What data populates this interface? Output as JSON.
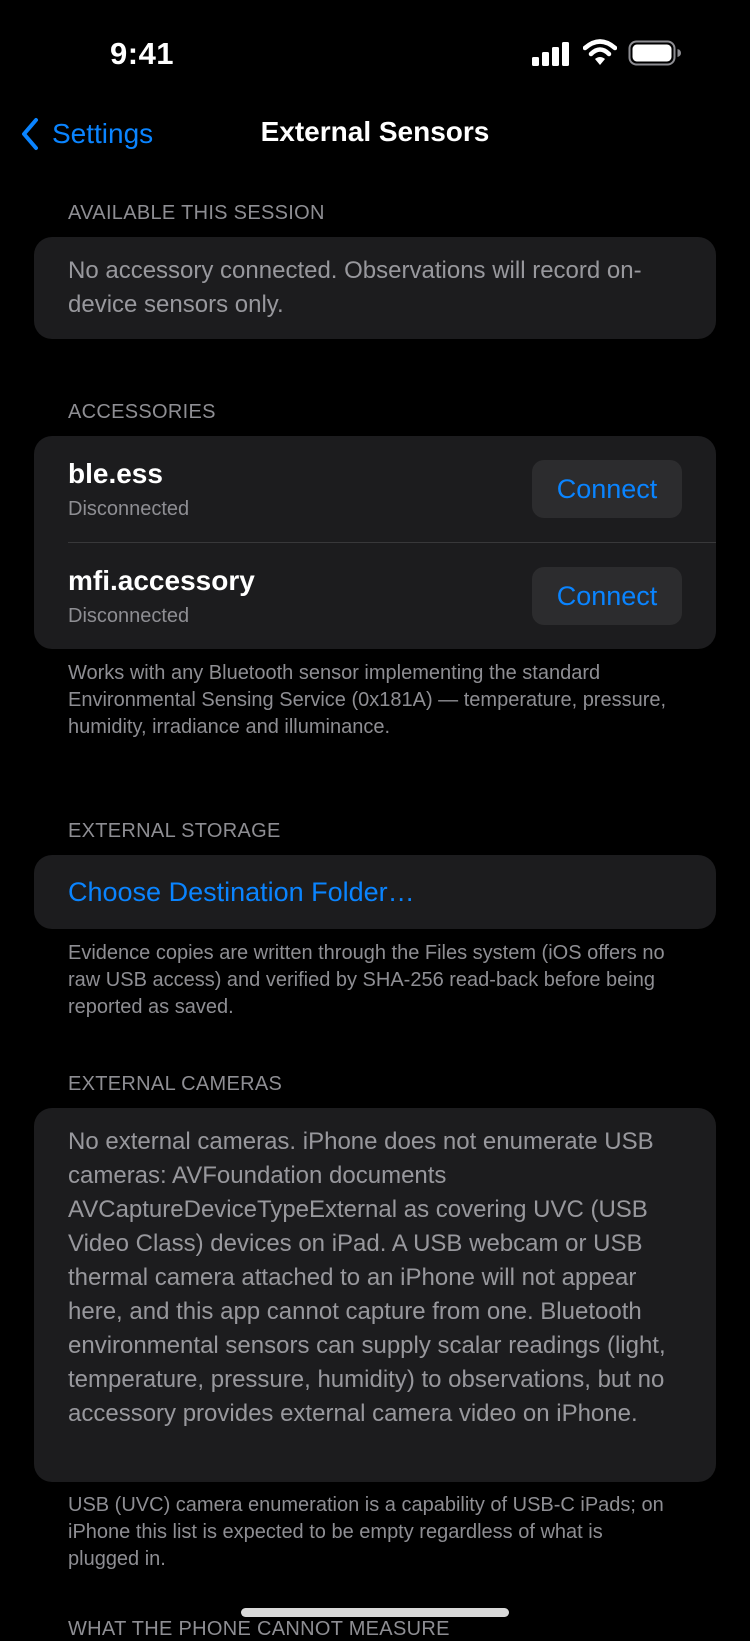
{
  "status_bar": {
    "time": "9:41",
    "icons": [
      "cellular-signal-icon",
      "wifi-icon",
      "battery-icon"
    ]
  },
  "nav": {
    "back_label": "Settings",
    "title": "External Sensors"
  },
  "sections": {
    "available": {
      "header": "AVAILABLE THIS SESSION",
      "text": "No accessory connected. Observations will record on-device sensors only."
    },
    "accessories": {
      "header": "ACCESSORIES",
      "items": [
        {
          "name": "ble.ess",
          "status": "Disconnected",
          "action": "Connect"
        },
        {
          "name": "mfi.accessory",
          "status": "Disconnected",
          "action": "Connect"
        }
      ],
      "footnote": "Works with any Bluetooth sensor implementing the standard Environmental Sensing Service (0x181A) — temperature, pressure, humidity, irradiance and illuminance."
    },
    "storage": {
      "header": "EXTERNAL STORAGE",
      "link": "Choose Destination Folder…",
      "footnote": "Evidence copies are written through the Files system (iOS offers no raw USB access) and verified by SHA-256 read-back before being reported as saved."
    },
    "cameras": {
      "header": "EXTERNAL CAMERAS",
      "text": "No external cameras. iPhone does not enumerate USB cameras: AVFoundation documents AVCaptureDeviceTypeExternal as covering UVC (USB Video Class) devices on iPad. A USB webcam or USB thermal camera attached to an iPhone will not appear here, and this app cannot capture from one. Bluetooth environmental sensors can supply scalar readings (light, temperature, pressure, humidity) to observations, but no accessory provides external camera video on iPhone.",
      "footnote": "USB (UVC) camera enumeration is a capability of USB-C iPads; on iPhone this list is expected to be empty regardless of what is plugged in."
    },
    "cut_off": {
      "header": "WHAT THE PHONE CANNOT MEASURE"
    }
  },
  "colors": {
    "background": "#000000",
    "card": "#1c1c1e",
    "accent": "#0a84ff",
    "secondary_text": "#8e8e93"
  }
}
